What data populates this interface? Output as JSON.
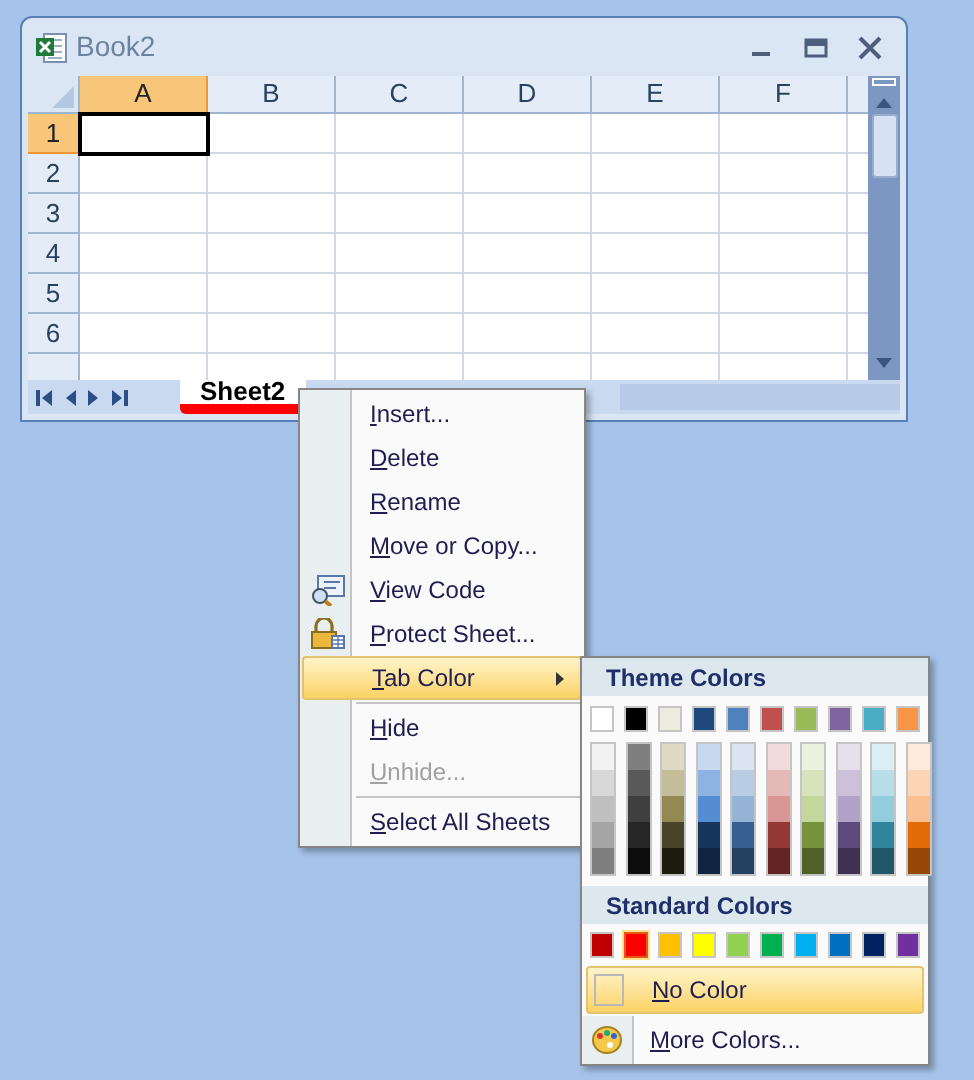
{
  "window": {
    "title": "Book2"
  },
  "columns": [
    {
      "label": "A",
      "selected": true
    },
    {
      "label": "B",
      "selected": false
    },
    {
      "label": "C",
      "selected": false
    },
    {
      "label": "D",
      "selected": false
    },
    {
      "label": "E",
      "selected": false
    },
    {
      "label": "F",
      "selected": false
    }
  ],
  "rows": [
    {
      "label": "1",
      "selected": true
    },
    {
      "label": "2",
      "selected": false
    },
    {
      "label": "3",
      "selected": false
    },
    {
      "label": "4",
      "selected": false
    },
    {
      "label": "5",
      "selected": false
    },
    {
      "label": "6",
      "selected": false
    }
  ],
  "sheet_tabs": [
    {
      "label": "Sheet2",
      "selected": true,
      "color": "#ff0000"
    }
  ],
  "context_menu": {
    "items": [
      {
        "kind": "item",
        "label": "Insert...",
        "disabled": false,
        "highlighted": false
      },
      {
        "kind": "item",
        "label": "Delete",
        "disabled": false,
        "highlighted": false
      },
      {
        "kind": "item",
        "label": "Rename",
        "disabled": false,
        "highlighted": false
      },
      {
        "kind": "item",
        "label": "Move or Copy...",
        "disabled": false,
        "highlighted": false
      },
      {
        "kind": "code_item",
        "label": "View Code",
        "disabled": false,
        "highlighted": false
      },
      {
        "kind": "lock_item",
        "label": "Protect Sheet...",
        "disabled": false,
        "highlighted": false
      },
      {
        "kind": "submenu",
        "label": "Tab Color",
        "disabled": false,
        "highlighted": true
      },
      {
        "kind": "separator"
      },
      {
        "kind": "item",
        "label": "Hide",
        "disabled": false,
        "highlighted": false
      },
      {
        "kind": "item",
        "label": "Unhide...",
        "disabled": true,
        "highlighted": false
      },
      {
        "kind": "separator"
      },
      {
        "kind": "item",
        "label": "Select All Sheets",
        "disabled": false,
        "highlighted": false
      }
    ]
  },
  "tab_color_menu": {
    "theme_header": "Theme Colors",
    "theme_colors": [
      {
        "color": "#ffffff",
        "shades": [
          {
            "color": "#f2f2f2"
          },
          {
            "color": "#d8d8d8"
          },
          {
            "color": "#bfbfbf"
          },
          {
            "color": "#a5a5a5"
          },
          {
            "color": "#7f7f7f"
          }
        ]
      },
      {
        "color": "#000000",
        "shades": [
          {
            "color": "#7f7f7f"
          },
          {
            "color": "#595959"
          },
          {
            "color": "#3f3f3f"
          },
          {
            "color": "#262626"
          },
          {
            "color": "#0c0c0c"
          }
        ]
      },
      {
        "color": "#eeece1",
        "shades": [
          {
            "color": "#ddd9c3"
          },
          {
            "color": "#c4bd97"
          },
          {
            "color": "#938953"
          },
          {
            "color": "#494429"
          },
          {
            "color": "#1d1b10"
          }
        ]
      },
      {
        "color": "#1f497d",
        "shades": [
          {
            "color": "#c6d9f0"
          },
          {
            "color": "#8db3e2"
          },
          {
            "color": "#548dd4"
          },
          {
            "color": "#17365d"
          },
          {
            "color": "#0f243e"
          }
        ]
      },
      {
        "color": "#4f81bd",
        "shades": [
          {
            "color": "#dbe5f1"
          },
          {
            "color": "#b8cce4"
          },
          {
            "color": "#95b3d7"
          },
          {
            "color": "#366092"
          },
          {
            "color": "#244061"
          }
        ]
      },
      {
        "color": "#c0504d",
        "shades": [
          {
            "color": "#f2dcdb"
          },
          {
            "color": "#e5b9b7"
          },
          {
            "color": "#d99694"
          },
          {
            "color": "#953734"
          },
          {
            "color": "#632423"
          }
        ]
      },
      {
        "color": "#9bbb59",
        "shades": [
          {
            "color": "#ebf1dd"
          },
          {
            "color": "#d7e3bc"
          },
          {
            "color": "#c3d69b"
          },
          {
            "color": "#76923c"
          },
          {
            "color": "#4f6128"
          }
        ]
      },
      {
        "color": "#8064a2",
        "shades": [
          {
            "color": "#e5e0ec"
          },
          {
            "color": "#ccc1d9"
          },
          {
            "color": "#b2a2c7"
          },
          {
            "color": "#5f497a"
          },
          {
            "color": "#3f3151"
          }
        ]
      },
      {
        "color": "#4bacc6",
        "shades": [
          {
            "color": "#dbeef3"
          },
          {
            "color": "#b7dde8"
          },
          {
            "color": "#92cddc"
          },
          {
            "color": "#31859b"
          },
          {
            "color": "#205867"
          }
        ]
      },
      {
        "color": "#f79646",
        "shades": [
          {
            "color": "#fdeada"
          },
          {
            "color": "#fbd5b5"
          },
          {
            "color": "#fac08f"
          },
          {
            "color": "#e36c09"
          },
          {
            "color": "#974806"
          }
        ]
      }
    ],
    "standard_header": "Standard Colors",
    "standard_colors": [
      {
        "color": "#c00000",
        "selected": false
      },
      {
        "color": "#ff0000",
        "selected": true
      },
      {
        "color": "#ffc000",
        "selected": false
      },
      {
        "color": "#ffff00",
        "selected": false
      },
      {
        "color": "#92d050",
        "selected": false
      },
      {
        "color": "#00b050",
        "selected": false
      },
      {
        "color": "#00b0f0",
        "selected": false
      },
      {
        "color": "#0070c0",
        "selected": false
      },
      {
        "color": "#002060",
        "selected": false
      },
      {
        "color": "#7030a0",
        "selected": false
      }
    ],
    "no_color": {
      "label": "No Color",
      "highlighted": true
    },
    "more_colors": {
      "label": "More Colors..."
    }
  }
}
